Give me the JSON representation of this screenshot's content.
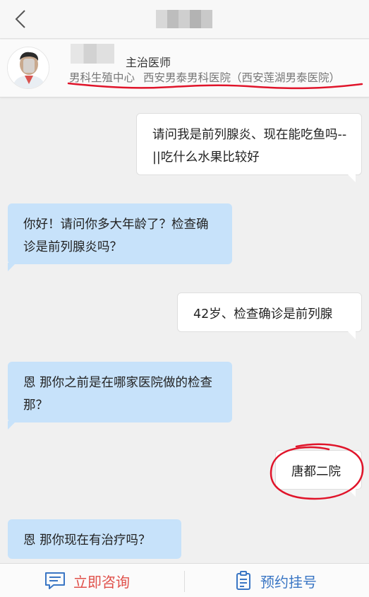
{
  "header": {
    "title": ""
  },
  "doctor": {
    "name": "",
    "title": "主治医师",
    "department": "男科生殖中心",
    "hospital": "西安男泰男科医院（西安莲湖男泰医院）"
  },
  "messages": [
    {
      "side": "right",
      "text": "请问我是前列腺炎、现在能吃鱼吗--||吃什么水果比较好"
    },
    {
      "side": "left",
      "text": "你好！请问你多大年龄了？检查确诊是前列腺炎吗？"
    },
    {
      "side": "right",
      "text": "42岁、检查确诊是前列腺"
    },
    {
      "side": "left",
      "text": "恩  那你之前是在哪家医院做的检查那？"
    },
    {
      "side": "right",
      "text": "唐都二院"
    },
    {
      "side": "left",
      "text": "恩  那你现在有治疗吗？"
    }
  ],
  "bottom_bar": {
    "consult_label": "立即咨询",
    "consult_icon": "chat-icon",
    "appointment_label": "预约挂号",
    "appointment_icon": "clipboard-icon"
  },
  "colors": {
    "left_bubble": "#c7e2fa",
    "right_bubble": "#ffffff",
    "consult_accent": "#e0504a",
    "appointment_accent": "#3a76c4",
    "annotation_red": "#e0142a"
  }
}
